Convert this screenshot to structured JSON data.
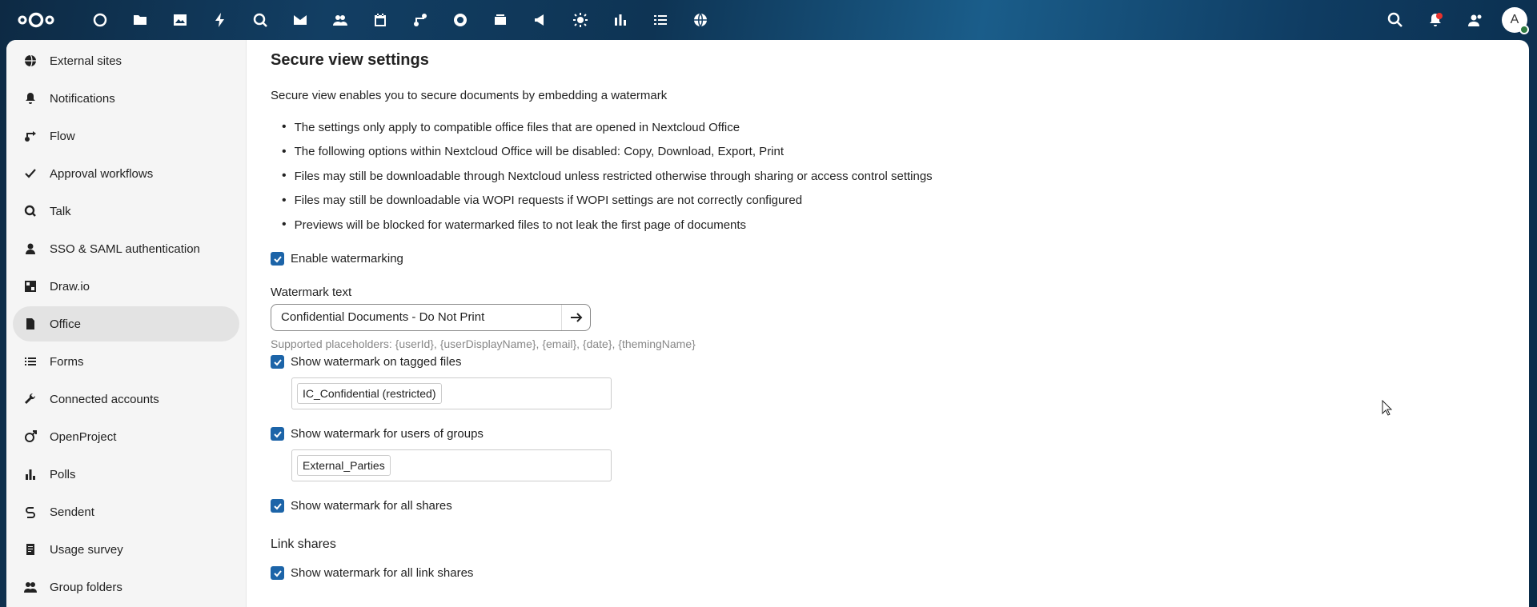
{
  "header": {
    "apps": [
      "dashboard-icon",
      "files-icon",
      "photos-icon",
      "activity-icon",
      "talk-icon",
      "mail-icon",
      "contacts-icon",
      "calendar-icon",
      "flow-icon",
      "github-icon",
      "deck-icon",
      "announcement-icon",
      "sun-icon",
      "analytics-icon",
      "tasks-icon",
      "globe-icon"
    ],
    "right": [
      "search-icon",
      "notifications-icon",
      "contacts-menu-icon"
    ],
    "avatar_initial": "A"
  },
  "sidebar": {
    "items": [
      {
        "label": "External sites",
        "icon": "globe-icon"
      },
      {
        "label": "Notifications",
        "icon": "bell-icon"
      },
      {
        "label": "Flow",
        "icon": "flow-icon"
      },
      {
        "label": "Approval workflows",
        "icon": "check-icon"
      },
      {
        "label": "Talk",
        "icon": "talk-icon"
      },
      {
        "label": "SSO & SAML authentication",
        "icon": "user-icon"
      },
      {
        "label": "Draw.io",
        "icon": "drawio-icon"
      },
      {
        "label": "Office",
        "icon": "office-icon"
      },
      {
        "label": "Forms",
        "icon": "list-icon"
      },
      {
        "label": "Connected accounts",
        "icon": "wrench-icon"
      },
      {
        "label": "OpenProject",
        "icon": "openproject-icon"
      },
      {
        "label": "Polls",
        "icon": "polls-icon"
      },
      {
        "label": "Sendent",
        "icon": "sendent-icon"
      },
      {
        "label": "Usage survey",
        "icon": "survey-icon"
      },
      {
        "label": "Group folders",
        "icon": "group-icon"
      }
    ],
    "active_index": 7
  },
  "main": {
    "title": "Secure view settings",
    "description": "Secure view enables you to secure documents by embedding a watermark",
    "bullets": [
      "The settings only apply to compatible office files that are opened in Nextcloud Office",
      "The following options within Nextcloud Office will be disabled: Copy, Download, Export, Print",
      "Files may still be downloadable through Nextcloud unless restricted otherwise through sharing or access control settings",
      "Files may still be downloadable via WOPI requests if WOPI settings are not correctly configured",
      "Previews will be blocked for watermarked files to not leak the first page of documents"
    ],
    "enable_watermarking": "Enable watermarking",
    "watermark_text_label": "Watermark text",
    "watermark_text_value": "Confidential Documents - Do Not Print",
    "placeholders_hint": "Supported placeholders: {userId}, {userDisplayName}, {email}, {date}, {themingName}",
    "tagged_files_label": "Show watermark on tagged files",
    "tagged_files_tag": "IC_Confidential (restricted)",
    "groups_label": "Show watermark for users of groups",
    "groups_tag": "External_Parties",
    "all_shares_label": "Show watermark for all shares",
    "link_shares_title": "Link shares",
    "link_shares_label": "Show watermark for all link shares"
  }
}
